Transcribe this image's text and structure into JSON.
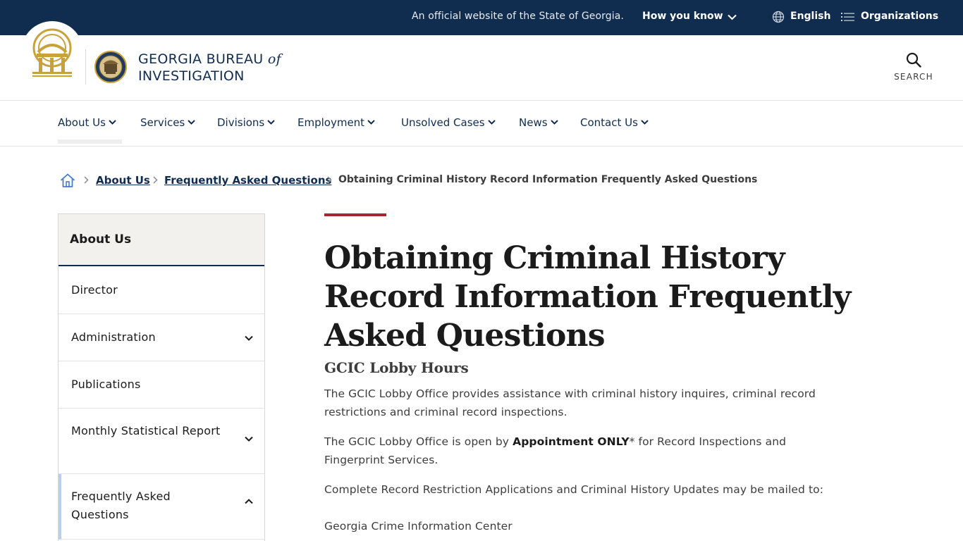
{
  "topbar": {
    "official_text": "An official website of the State of Georgia.",
    "how_you_know": "How you know",
    "language": "English",
    "organizations": "Organizations"
  },
  "header": {
    "agency_line1": "GEORGIA BUREAU",
    "agency_of": "of",
    "agency_line2": "INVESTIGATION",
    "search_label": "SEARCH"
  },
  "nav": {
    "items": [
      {
        "label": "About Us"
      },
      {
        "label": "Services"
      },
      {
        "label": "Divisions"
      },
      {
        "label": "Employment"
      },
      {
        "label": "Unsolved Cases"
      },
      {
        "label": "News"
      },
      {
        "label": "Contact Us"
      }
    ]
  },
  "breadcrumb": {
    "items": [
      "About Us",
      "Frequently Asked Questions"
    ],
    "current": "Obtaining Criminal History Record Information Frequently Asked Questions"
  },
  "sidebar": {
    "title": "About Us",
    "items": [
      {
        "label": "Director",
        "expandable": false
      },
      {
        "label": "Administration",
        "expandable": true
      },
      {
        "label": "Publications",
        "expandable": false
      },
      {
        "label": "Monthly Statistical Report",
        "expandable": true
      },
      {
        "label": "Frequently Asked Questions",
        "expandable": true,
        "expanded": true
      }
    ]
  },
  "content": {
    "title": "Obtaining Criminal History Record Information Frequently Asked Questions",
    "subtitle": "GCIC Lobby Hours",
    "p1": "The GCIC Lobby Office provides assistance with criminal history inquires, criminal record restrictions and criminal record inspections.",
    "p2_before": "The GCIC Lobby Office is open by",
    "p2_bold": "Appointment ONLY",
    "p2_after": "* for Record Inspections and Fingerprint Services.",
    "p3": "Complete Record Restriction Applications and Criminal History Updates may be mailed to:",
    "p4": "Georgia Crime Information Center"
  },
  "colors": {
    "navy": "#102c4e",
    "accent_red": "#a4262c",
    "gold": "#c9a13b"
  }
}
